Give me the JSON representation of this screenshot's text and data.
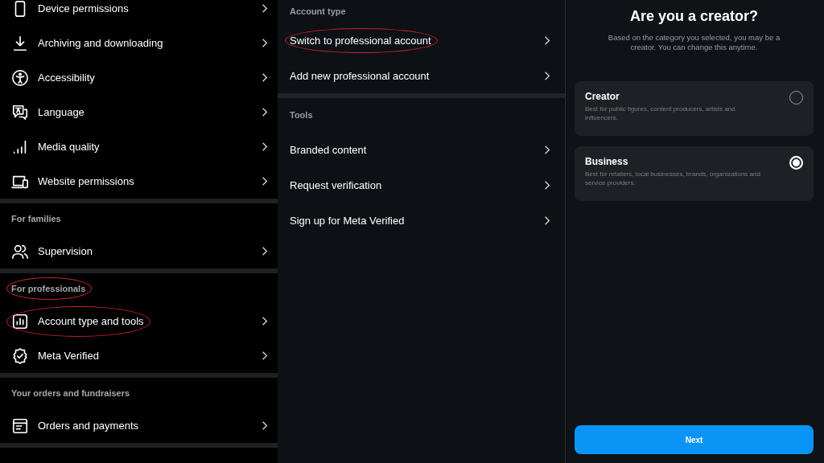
{
  "settings_panel": {
    "sections": [
      {
        "items": [
          {
            "label": "Device permissions",
            "highlighted": false
          },
          {
            "label": "Archiving and downloading",
            "highlighted": false
          },
          {
            "label": "Accessibility",
            "highlighted": false
          },
          {
            "label": "Language",
            "highlighted": false
          },
          {
            "label": "Media quality",
            "highlighted": false
          },
          {
            "label": "Website permissions",
            "highlighted": false
          }
        ]
      },
      {
        "header": {
          "text": "For families",
          "highlighted": false
        },
        "items": [
          {
            "label": "Supervision",
            "highlighted": false
          }
        ]
      },
      {
        "header": {
          "text": "For professionals",
          "highlighted": true
        },
        "items": [
          {
            "label": "Account type and tools",
            "highlighted": true
          },
          {
            "label": "Meta Verified",
            "highlighted": false
          }
        ]
      },
      {
        "header": {
          "text": "Your orders and fundraisers",
          "highlighted": false
        },
        "items": [
          {
            "label": "Orders and payments",
            "highlighted": false
          }
        ]
      }
    ]
  },
  "account_panel": {
    "sections": [
      {
        "header": "Account type",
        "items": [
          {
            "label": "Switch to professional account",
            "highlighted": true
          },
          {
            "label": "Add new professional account",
            "highlighted": false
          }
        ]
      },
      {
        "header": "Tools",
        "items": [
          {
            "label": "Branded content",
            "highlighted": false
          },
          {
            "label": "Request verification",
            "highlighted": false
          },
          {
            "label": "Sign up for Meta Verified",
            "highlighted": false
          }
        ]
      }
    ]
  },
  "creator_panel": {
    "title": "Are you a creator?",
    "subtitle": "Based on the category you selected, you may be a creator. You can change this anytime.",
    "options": [
      {
        "title": "Creator",
        "description": "Best for public figures, content producers, artists and influencers.",
        "selected": false
      },
      {
        "title": "Business",
        "description": "Best for retailers, local businesses, brands, organizations and service providers.",
        "selected": true
      }
    ],
    "button": "Next"
  }
}
